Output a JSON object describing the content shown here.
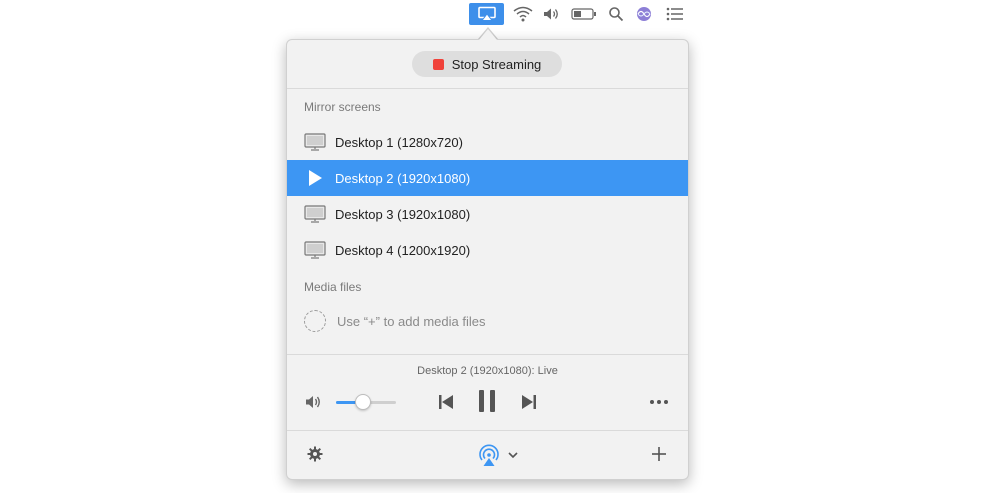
{
  "menubar": {
    "icons": [
      {
        "name": "airplay-icon",
        "active": true
      },
      {
        "name": "wifi-icon"
      },
      {
        "name": "volume-icon"
      },
      {
        "name": "battery-icon"
      },
      {
        "name": "search-icon"
      },
      {
        "name": "siri-icon"
      },
      {
        "name": "list-icon"
      }
    ]
  },
  "popover": {
    "stop_button_label": "Stop Streaming",
    "mirror_section_label": "Mirror screens",
    "screens": [
      {
        "label": "Desktop 1 (1280x720)",
        "selected": false
      },
      {
        "label": "Desktop 2 (1920x1080)",
        "selected": true
      },
      {
        "label": "Desktop 3 (1920x1080)",
        "selected": false
      },
      {
        "label": "Desktop 4 (1200x1920)",
        "selected": false
      }
    ],
    "media_section_label": "Media files",
    "media_hint": "Use “+” to add media files",
    "now_playing": "Desktop 2 (1920x1080): Live",
    "volume_level": 0.45
  },
  "colors": {
    "accent": "#3d96f3",
    "stop": "#f0423a",
    "menubar_active": "#3d8fea"
  }
}
